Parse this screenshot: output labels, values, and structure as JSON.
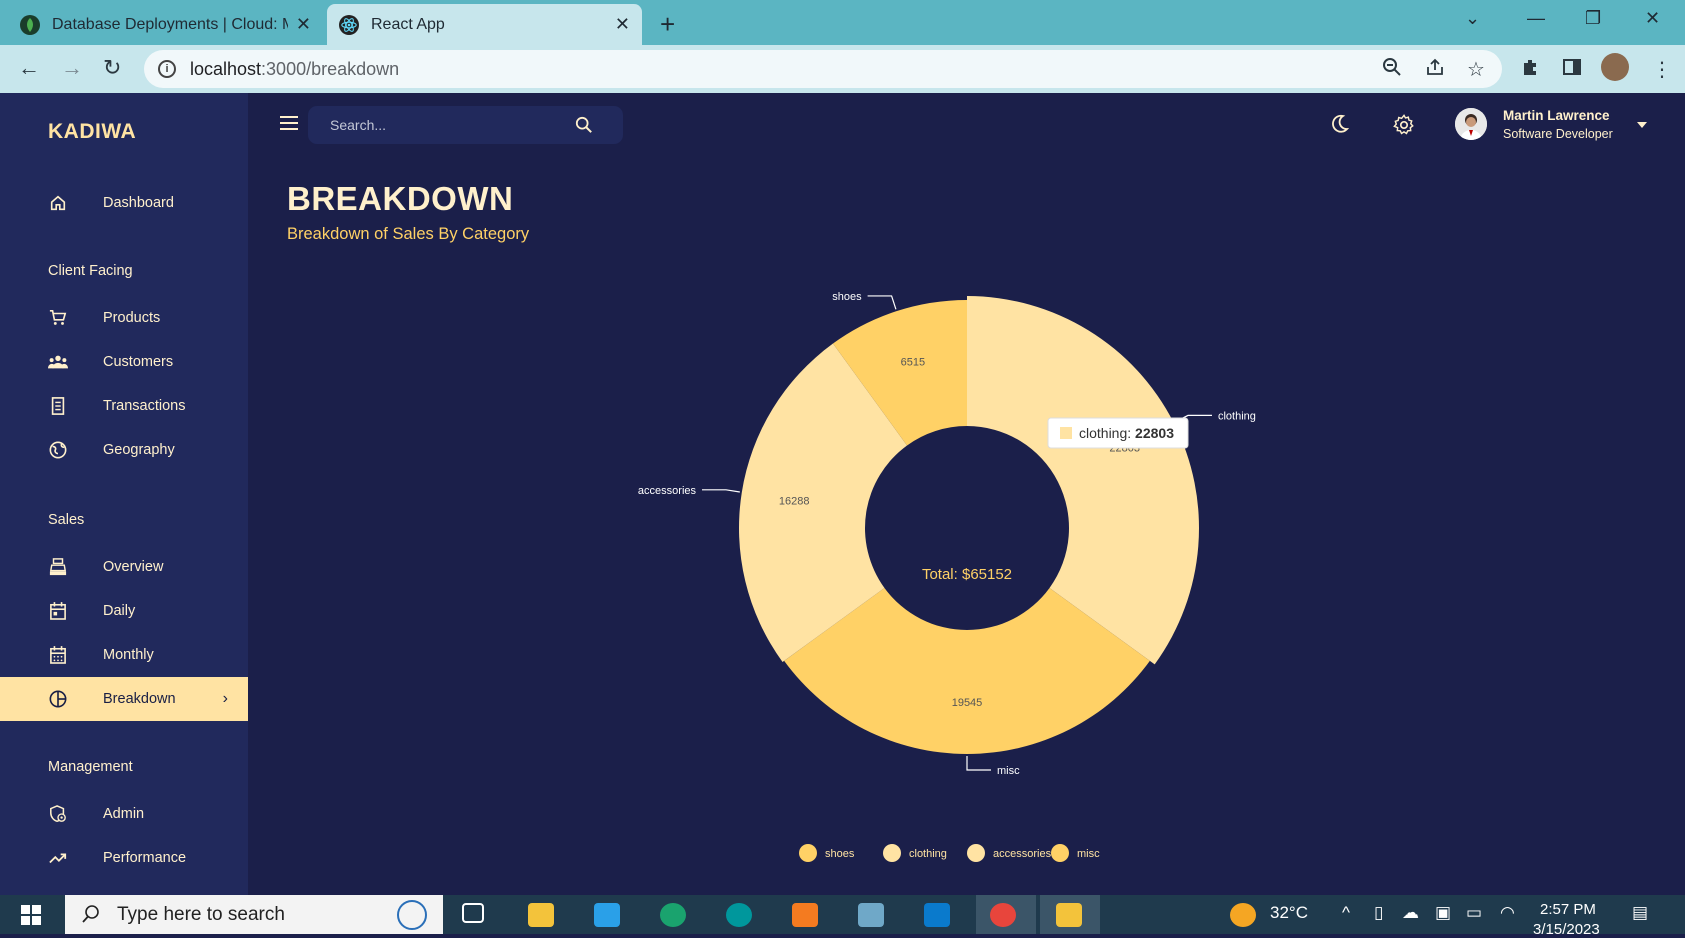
{
  "browser": {
    "tabs": [
      {
        "title": "Database Deployments | Cloud: M",
        "active": false,
        "icon": "mongodb-leaf-icon"
      },
      {
        "title": "React App",
        "active": true,
        "icon": "react-icon"
      }
    ],
    "url_host": "localhost",
    "url_path": ":3000/breakdown"
  },
  "app": {
    "brand": "KADIWA",
    "search_placeholder": "Search...",
    "user": {
      "name": "Martin Lawrence",
      "role": "Software Developer"
    },
    "nav": [
      {
        "type": "item",
        "label": "Dashboard",
        "icon": "home-icon"
      },
      {
        "type": "section",
        "label": "Client Facing"
      },
      {
        "type": "item",
        "label": "Products",
        "icon": "cart-icon"
      },
      {
        "type": "item",
        "label": "Customers",
        "icon": "groups-icon"
      },
      {
        "type": "item",
        "label": "Transactions",
        "icon": "receipt-icon"
      },
      {
        "type": "item",
        "label": "Geography",
        "icon": "globe-icon"
      },
      {
        "type": "section",
        "label": "Sales"
      },
      {
        "type": "item",
        "label": "Overview",
        "icon": "point-of-sale-icon"
      },
      {
        "type": "item",
        "label": "Daily",
        "icon": "calendar-today-icon"
      },
      {
        "type": "item",
        "label": "Monthly",
        "icon": "calendar-month-icon"
      },
      {
        "type": "item",
        "label": "Breakdown",
        "icon": "pie-chart-icon",
        "active": true
      },
      {
        "type": "section",
        "label": "Management"
      },
      {
        "type": "item",
        "label": "Admin",
        "icon": "admin-icon"
      },
      {
        "type": "item",
        "label": "Performance",
        "icon": "trending-up-icon"
      }
    ],
    "page": {
      "title": "BREAKDOWN",
      "subtitle": "Breakdown of Sales By Category"
    }
  },
  "chart_data": {
    "type": "pie",
    "subtype": "donut",
    "categories": [
      "shoes",
      "clothing",
      "accessories",
      "misc"
    ],
    "values": [
      6515,
      22803,
      16288,
      19545
    ],
    "colors": [
      "#ffd166",
      "#ffe3a3",
      "#ffe3a3",
      "#ffd166"
    ],
    "center_label": "Total: $65152",
    "tooltip": {
      "label": "clothing",
      "value": "22803"
    },
    "legend": "bottom"
  },
  "taskbar": {
    "search_placeholder": "Type here to search",
    "weather": "32°C",
    "time": "2:57 PM",
    "date": "3/15/2023"
  }
}
